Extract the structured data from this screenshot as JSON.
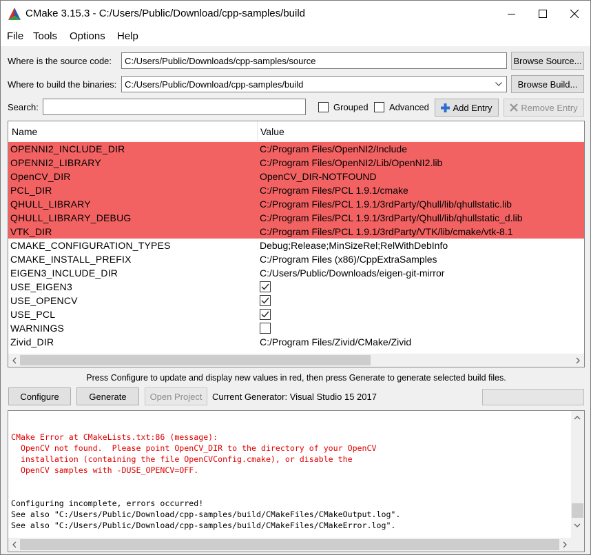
{
  "window": {
    "title": "CMake 3.15.3 - C:/Users/Public/Download/cpp-samples/build"
  },
  "menu": {
    "file": "File",
    "tools": "Tools",
    "options": "Options",
    "help": "Help"
  },
  "paths": {
    "source_label": "Where is the source code:",
    "source_value": "C:/Users/Public/Downloads/cpp-samples/source",
    "browse_source": "Browse Source...",
    "build_label": "Where to build the binaries:",
    "build_value": "C:/Users/Public/Download/cpp-samples/build",
    "browse_build": "Browse Build..."
  },
  "search": {
    "label": "Search:",
    "value": "",
    "grouped_label": "Grouped",
    "grouped_checked": false,
    "advanced_label": "Advanced",
    "advanced_checked": false,
    "add_entry": "Add Entry",
    "remove_entry": "Remove Entry"
  },
  "table": {
    "col_name": "Name",
    "col_value": "Value",
    "highlight_color": "#f36262",
    "rows": [
      {
        "name": "OPENNI2_INCLUDE_DIR",
        "value": "C:/Program Files/OpenNI2/Include",
        "new": true
      },
      {
        "name": "OPENNI2_LIBRARY",
        "value": "C:/Program Files/OpenNI2/Lib/OpenNI2.lib",
        "new": true
      },
      {
        "name": "OpenCV_DIR",
        "value": "OpenCV_DIR-NOTFOUND",
        "new": true
      },
      {
        "name": "PCL_DIR",
        "value": "C:/Program Files/PCL 1.9.1/cmake",
        "new": true
      },
      {
        "name": "QHULL_LIBRARY",
        "value": "C:/Program Files/PCL 1.9.1/3rdParty/Qhull/lib/qhullstatic.lib",
        "new": true
      },
      {
        "name": "QHULL_LIBRARY_DEBUG",
        "value": "C:/Program Files/PCL 1.9.1/3rdParty/Qhull/lib/qhullstatic_d.lib",
        "new": true
      },
      {
        "name": "VTK_DIR",
        "value": "C:/Program Files/PCL 1.9.1/3rdParty/VTK/lib/cmake/vtk-8.1",
        "new": true
      },
      {
        "name": "CMAKE_CONFIGURATION_TYPES",
        "value": "Debug;Release;MinSizeRel;RelWithDebInfo",
        "new": false
      },
      {
        "name": "CMAKE_INSTALL_PREFIX",
        "value": "C:/Program Files (x86)/CppExtraSamples",
        "new": false
      },
      {
        "name": "EIGEN3_INCLUDE_DIR",
        "value": "C:/Users/Public/Downloads/eigen-git-mirror",
        "new": false
      },
      {
        "name": "USE_EIGEN3",
        "checkbox": true,
        "checked": true,
        "new": false
      },
      {
        "name": "USE_OPENCV",
        "checkbox": true,
        "checked": true,
        "new": false
      },
      {
        "name": "USE_PCL",
        "checkbox": true,
        "checked": true,
        "new": false
      },
      {
        "name": "WARNINGS",
        "checkbox": true,
        "checked": false,
        "new": false
      },
      {
        "name": "Zivid_DIR",
        "value": "C:/Program Files/Zivid/CMake/Zivid",
        "new": false
      }
    ]
  },
  "hint": "Press Configure to update and display new values in red, then press Generate to generate selected build files.",
  "actions": {
    "configure": "Configure",
    "generate": "Generate",
    "open_project": "Open Project",
    "generator_text": "Current Generator: Visual Studio 15 2017"
  },
  "output": {
    "error_color": "#e00000",
    "lines": [
      {
        "text": "CMake Error at CMakeLists.txt:86 (message):",
        "error": true
      },
      {
        "text": "  OpenCV not found.  Please point OpenCV_DIR to the directory of your OpenCV",
        "error": true
      },
      {
        "text": "  installation (containing the file OpenCVConfig.cmake), or disable the",
        "error": true
      },
      {
        "text": "  OpenCV samples with -DUSE_OPENCV=OFF.",
        "error": true
      },
      {
        "text": "",
        "error": false
      },
      {
        "text": "",
        "error": false
      },
      {
        "text": "Configuring incomplete, errors occurred!",
        "error": false
      },
      {
        "text": "See also \"C:/Users/Public/Download/cpp-samples/build/CMakeFiles/CMakeOutput.log\".",
        "error": false
      },
      {
        "text": "See also \"C:/Users/Public/Download/cpp-samples/build/CMakeFiles/CMakeError.log\".",
        "error": false
      }
    ]
  }
}
